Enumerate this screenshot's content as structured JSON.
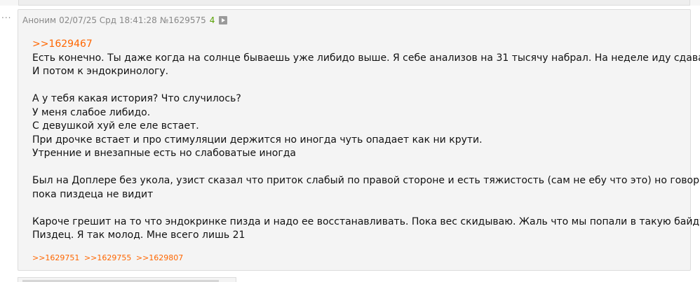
{
  "post": {
    "author": "Аноним",
    "date": "02/07/25 Срд 18:41:28",
    "number": "№1629575",
    "replies_count": "4",
    "quote_link": ">>1629467",
    "lines": [
      "Есть конечно. Ты даже когда на солнце бываешь уже либидо выше. Я себе анализов на 31 тысячу набрал. На неделе иду сдавать.",
      "И потом к эндокринологу.",
      "А у тебя какая история? Что случилось?",
      "У меня слабое либидо.",
      "С девушкой хуй еле еле встает.",
      "При дрочке встает и про стимуляции держится но иногда чуть опадает как ни крути.",
      "Утренние и внезапные есть но слабоватые иногда",
      "Был на Доплере без укола, узист сказал что приток слабый по правой стороне и есть тяжистость (сам не ебу что это) но говорит",
      "пока пиздеца не видит",
      "Кароче грешит на то что эндокринке пизда и надо ее восстанавливать. Пока вес скидываю. Жаль что мы попали в такую байду.",
      "Пиздец. Я так молод. Мне всего лишь 21"
    ],
    "reply_links": [
      ">>1629751",
      ">>1629755",
      ">>1629807"
    ]
  },
  "ui": {
    "collapse_glyph": "...",
    "play_icon": "play-icon"
  },
  "colors": {
    "link": "#ff6600",
    "replies_count": "#56a000",
    "meta": "#888888",
    "post_bg": "#f4f4f4"
  }
}
